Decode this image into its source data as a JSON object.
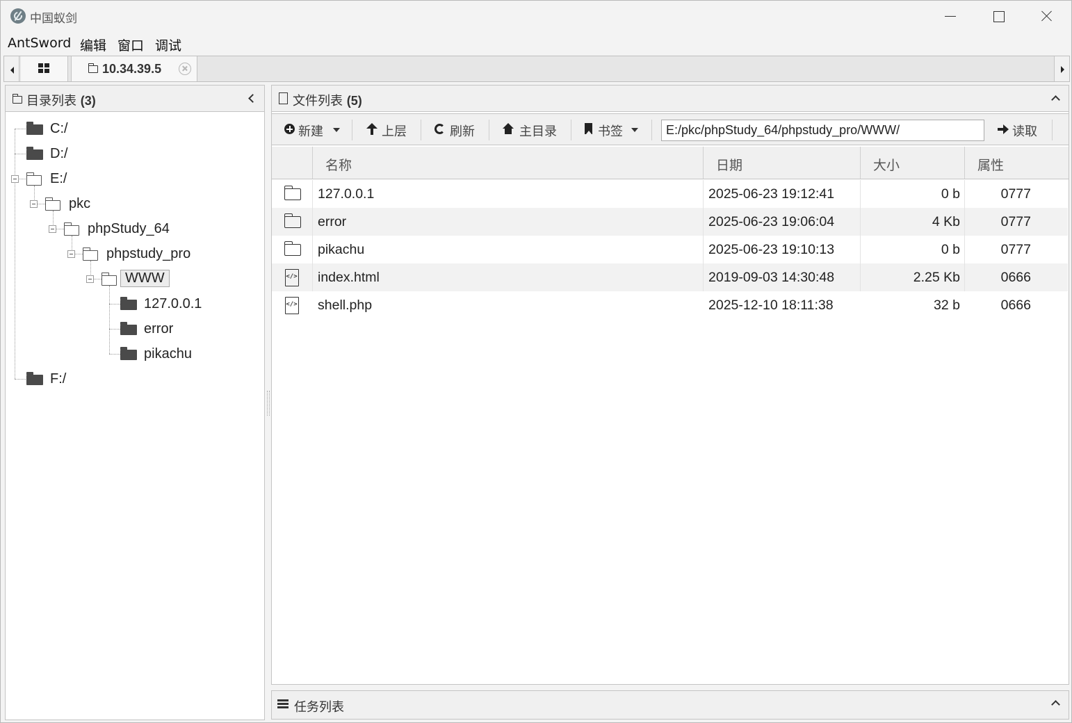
{
  "window": {
    "title": "中国蚁剑"
  },
  "menu": [
    "AntSword",
    "编辑",
    "窗口",
    "调试"
  ],
  "tabs": {
    "host_label": "10.34.39.5"
  },
  "left_panel": {
    "title": "目录列表",
    "count": "(3)",
    "tree": [
      {
        "label": "C:/",
        "level": 0,
        "state": "collapsed"
      },
      {
        "label": "D:/",
        "level": 0,
        "state": "collapsed"
      },
      {
        "label": "E:/",
        "level": 0,
        "state": "expanded"
      },
      {
        "label": "pkc",
        "level": 1,
        "state": "expanded"
      },
      {
        "label": "phpStudy_64",
        "level": 2,
        "state": "expanded"
      },
      {
        "label": "phpstudy_pro",
        "level": 3,
        "state": "expanded"
      },
      {
        "label": "WWW",
        "level": 4,
        "state": "expanded",
        "selected": true
      },
      {
        "label": "127.0.0.1",
        "level": 5,
        "state": "collapsed"
      },
      {
        "label": "error",
        "level": 5,
        "state": "collapsed"
      },
      {
        "label": "pikachu",
        "level": 5,
        "state": "collapsed"
      },
      {
        "label": "F:/",
        "level": 0,
        "state": "collapsed"
      }
    ]
  },
  "right_panel": {
    "title": "文件列表",
    "count": "(5)",
    "toolbar": {
      "new_label": "新建",
      "up_label": "上层",
      "refresh_label": "刷新",
      "home_label": "主目录",
      "bookmark_label": "书签",
      "path_value": "E:/pkc/phpStudy_64/phpstudy_pro/WWW/",
      "read_label": "读取"
    },
    "columns": [
      "名称",
      "日期",
      "大小",
      "属性"
    ],
    "rows": [
      {
        "type": "folder",
        "name": "127.0.0.1",
        "date": "2025-06-23 19:12:41",
        "size": "0 b",
        "perm": "0777"
      },
      {
        "type": "folder",
        "name": "error",
        "date": "2025-06-23 19:06:04",
        "size": "4 Kb",
        "perm": "0777"
      },
      {
        "type": "folder",
        "name": "pikachu",
        "date": "2025-06-23 19:10:13",
        "size": "0 b",
        "perm": "0777"
      },
      {
        "type": "code",
        "name": "index.html",
        "date": "2019-09-03 14:30:48",
        "size": "2.25 Kb",
        "perm": "0666"
      },
      {
        "type": "code",
        "name": "shell.php",
        "date": "2025-12-10 18:11:38",
        "size": "32 b",
        "perm": "0666"
      }
    ]
  },
  "task_panel": {
    "title": "任务列表"
  },
  "colors": {
    "chrome": "#f3f3f3",
    "panel_header": "#f0f0f0",
    "border": "#c4c4c4",
    "row_alt": "#f2f2f2"
  }
}
